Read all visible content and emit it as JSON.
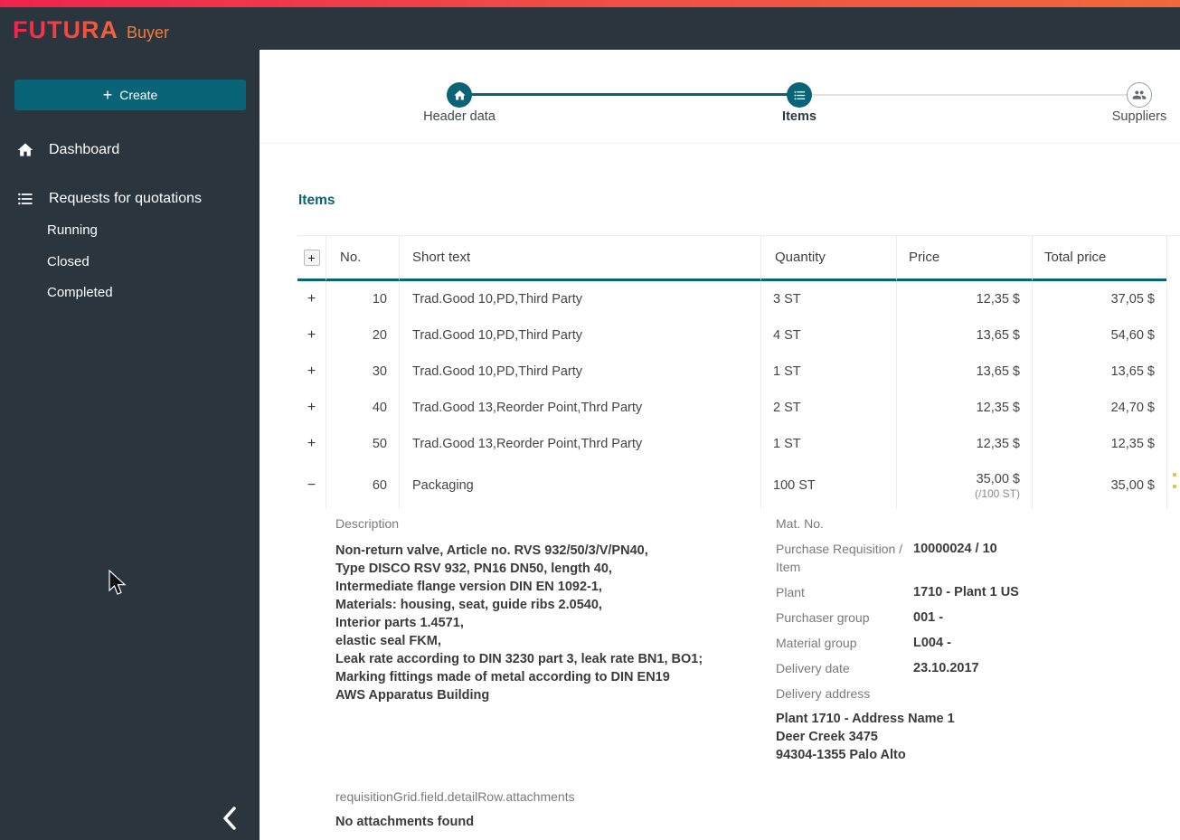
{
  "brand": {
    "name": "FUTURA",
    "product": "Buyer"
  },
  "sidebar": {
    "create": {
      "plus": "+",
      "label": "Create"
    },
    "nav": [
      {
        "label": "Dashboard"
      },
      {
        "label": "Requests for quotations"
      }
    ],
    "subnav": [
      "Running",
      "Closed",
      "Completed"
    ]
  },
  "stepper": {
    "steps": [
      {
        "label": "Header data"
      },
      {
        "label": "Items"
      },
      {
        "label": "Suppliers"
      }
    ]
  },
  "items": {
    "title": "Items",
    "headers": {
      "expander": "+",
      "no": "No.",
      "short_text": "Short text",
      "quantity": "Quantity",
      "price": "Price",
      "total_price": "Total price"
    },
    "rows": [
      {
        "expander": "+",
        "no": "10",
        "short_text": "Trad.Good 10,PD,Third Party",
        "quantity": "3 ST",
        "price": "12,35 $",
        "total_price": "37,05 $"
      },
      {
        "expander": "+",
        "no": "20",
        "short_text": "Trad.Good 10,PD,Third Party",
        "quantity": "4 ST",
        "price": "13,65 $",
        "total_price": "54,60 $"
      },
      {
        "expander": "+",
        "no": "30",
        "short_text": "Trad.Good 10,PD,Third Party",
        "quantity": "1 ST",
        "price": "13,65 $",
        "total_price": "13,65 $"
      },
      {
        "expander": "+",
        "no": "40",
        "short_text": "Trad.Good 13,Reorder Point,Thrd Party",
        "quantity": "2 ST",
        "price": "12,35 $",
        "total_price": "24,70 $"
      },
      {
        "expander": "+",
        "no": "50",
        "short_text": "Trad.Good 13,Reorder Point,Thrd Party",
        "quantity": "1 ST",
        "price": "12,35 $",
        "total_price": "12,35 $"
      },
      {
        "expander": "−",
        "no": "60",
        "short_text": "Packaging",
        "quantity": "100 ST",
        "price": "35,00 $",
        "price_unit": "(/100 ST)",
        "total_price": "35,00 $"
      }
    ]
  },
  "detail": {
    "description_label": "Description",
    "description_lines": [
      "Non-return valve, Article no. RVS 932/50/3/V/PN40,",
      "Type DISCO RSV 932, PN16 DN50, length 40,",
      "Intermediate flange version DIN EN 1092-1,",
      "Materials: housing, seat, guide ribs 2.0540,",
      "Interior parts 1.4571,",
      "elastic seal FKM,",
      "Leak rate according to DIN 3230 part 3, leak rate BN1, BO1;",
      "Marking fittings made of metal according to DIN EN19",
      "AWS Apparatus Building"
    ],
    "fields": [
      {
        "label": "Mat. No.",
        "value": ""
      },
      {
        "label": "Purchase Requisition / Item",
        "value": "10000024 / 10"
      },
      {
        "label": "Plant",
        "value": "1710 - Plant 1 US"
      },
      {
        "label": "Purchaser group",
        "value": "001 -"
      },
      {
        "label": "Material group",
        "value": "L004 -"
      },
      {
        "label": "Delivery date",
        "value": "23.10.2017"
      },
      {
        "label": "Delivery address",
        "value": ""
      }
    ],
    "address_lines": [
      "Plant 1710 - Address Name 1",
      "Deer Creek 3475",
      "94304-1355 Palo Alto"
    ],
    "attachments_label": "requisitionGrid.field.detailRow.attachments",
    "attachments_empty": "No attachments found"
  },
  "colors": {
    "accent_teal": "#0a6478",
    "brand_gradient_start": "#f0234e",
    "brand_gradient_end": "#f0683c",
    "sidebar_dark": "#2a353e"
  }
}
